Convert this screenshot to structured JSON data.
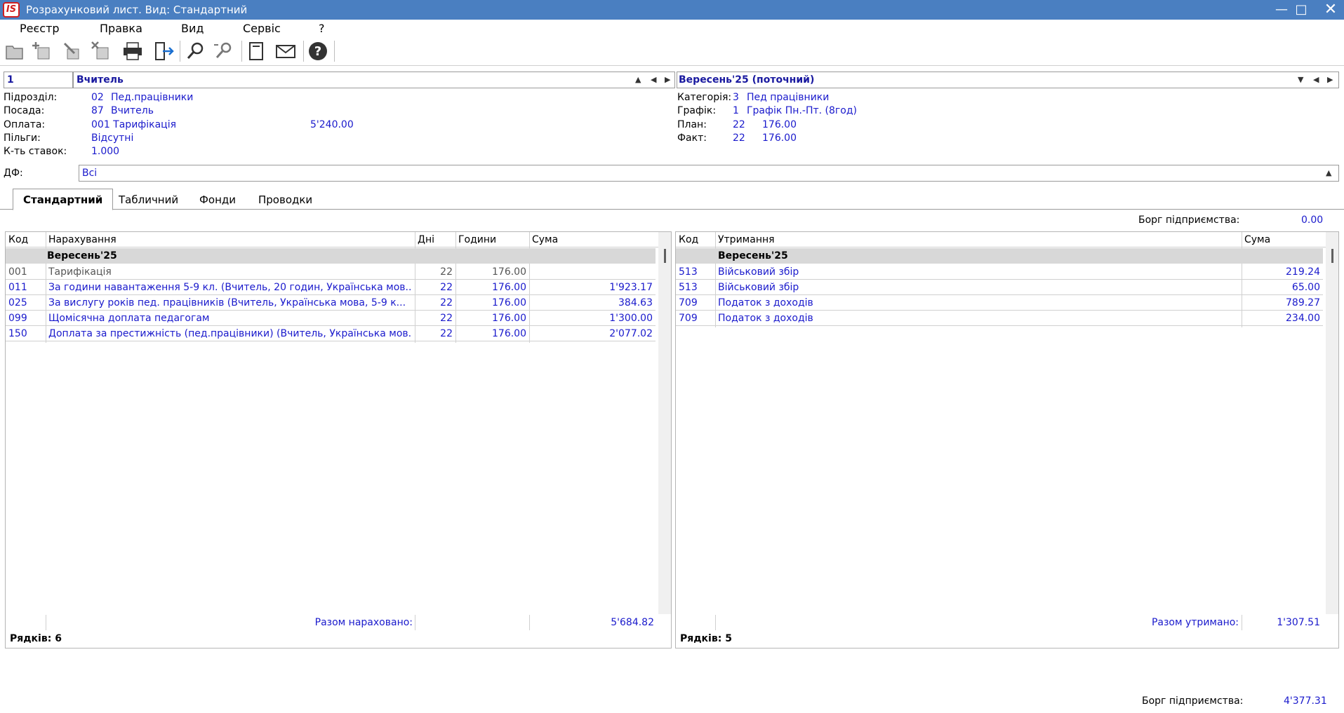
{
  "window": {
    "logo_text": "IS",
    "title": "Розрахунковий лист. Вид: Стандартний"
  },
  "menu": {
    "items": [
      "Реєстр",
      "Правка",
      "Вид",
      "Сервіс",
      "?"
    ]
  },
  "toolbar": {
    "icons": [
      "open-icon",
      "add-icon",
      "edit-icon",
      "delete-icon",
      "print-icon",
      "export-icon",
      "find-icon",
      "find-next-icon",
      "page-icon",
      "mail-icon",
      "help-icon"
    ]
  },
  "employee": {
    "number": "1",
    "name": "Вчитель"
  },
  "period": {
    "value": "Вересень'25 (поточний)"
  },
  "info": {
    "department_label": "Підрозділ:",
    "department_code": "02",
    "department_name": "Пед.працівники",
    "position_label": "Посада:",
    "position_code": "87",
    "position_name": "Вчитель",
    "pay_label": "Оплата:",
    "pay_value": "001 Тарифікація",
    "pay_amount": "5'240.00",
    "benefits_label": "Пільги:",
    "benefits_value": "Відсутні",
    "rate_label": "К-ть ставок:",
    "rate_value": "1.000",
    "category_label": "Категорія:",
    "category_code": "3",
    "category_name": "Пед працівники",
    "schedule_label": "Графік:",
    "schedule_code": "1",
    "schedule_name": "Графік Пн.-Пт. (8год)",
    "plan_label": "План:",
    "plan_days": "22",
    "plan_hours": "176.00",
    "fact_label": "Факт:",
    "fact_days": "22",
    "fact_hours": "176.00"
  },
  "df": {
    "label": "ДФ:",
    "value": "Всі"
  },
  "tabs": [
    "Стандартний",
    "Табличний",
    "Фонди",
    "Проводки"
  ],
  "debt_top": {
    "label": "Борг підприємства:",
    "value": "0.00"
  },
  "accruals": {
    "headers": {
      "code": "Код",
      "name": "Нарахування",
      "days": "Дні",
      "hours": "Години",
      "sum": "Сума"
    },
    "group": "Вересень'25",
    "rows": [
      {
        "code": "001",
        "name": "Тарифікація",
        "days": "22",
        "hours": "176.00",
        "sum": ""
      },
      {
        "code": "011",
        "name": "За години навантаження 5-9 кл. (Вчитель, 20 годин, Українська мов...",
        "days": "22",
        "hours": "176.00",
        "sum": "1'923.17"
      },
      {
        "code": "025",
        "name": "За вислугу років пед. працівників (Вчитель, Українська мова, 5-9 к...",
        "days": "22",
        "hours": "176.00",
        "sum": "384.63"
      },
      {
        "code": "099",
        "name": "Щомісячна доплата педагогам",
        "days": "22",
        "hours": "176.00",
        "sum": "1'300.00"
      },
      {
        "code": "150",
        "name": "Доплата за престижність (пед.працівники) (Вчитель, Українська мов...",
        "days": "22",
        "hours": "176.00",
        "sum": "2'077.02"
      }
    ],
    "total_label": "Разом нараховано:",
    "total_value": "5'684.82",
    "rows_count": "Рядків: 6"
  },
  "deductions": {
    "headers": {
      "code": "Код",
      "name": "Утримання",
      "sum": "Сума"
    },
    "group": "Вересень'25",
    "rows": [
      {
        "code": "513",
        "name": "Військовий збір",
        "sum": "219.24"
      },
      {
        "code": "513",
        "name": "Військовий збір",
        "sum": "65.00"
      },
      {
        "code": "709",
        "name": "Податок з доходів",
        "sum": "789.27"
      },
      {
        "code": "709",
        "name": "Податок з доходів",
        "sum": "234.00"
      }
    ],
    "total_label": "Разом утримано:",
    "total_value": "1'307.51",
    "rows_count": "Рядків: 5"
  },
  "debt_bottom": {
    "label": "Борг підприємства:",
    "value": "4'377.31"
  }
}
